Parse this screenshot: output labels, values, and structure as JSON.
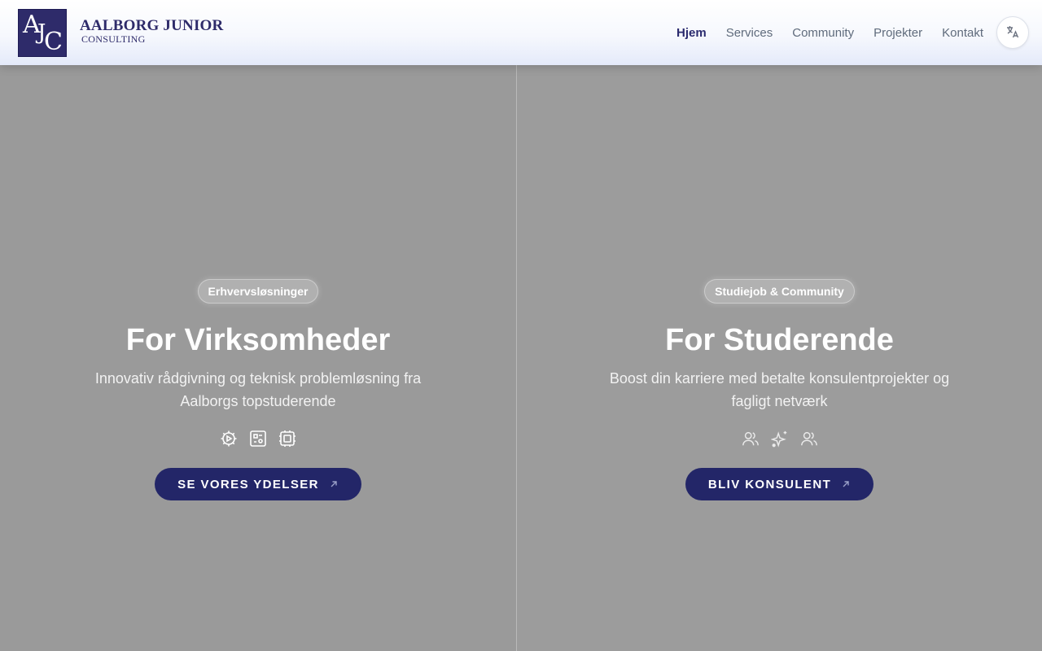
{
  "header": {
    "logo": {
      "mark": {
        "a": "A",
        "j": "J",
        "c": "C"
      },
      "line1": "AALBORG JUNIOR",
      "line2": "CONSULTING"
    },
    "nav": [
      {
        "label": "Hjem",
        "active": true
      },
      {
        "label": "Services",
        "active": false
      },
      {
        "label": "Community",
        "active": false
      },
      {
        "label": "Projekter",
        "active": false
      },
      {
        "label": "Kontakt",
        "active": false
      }
    ],
    "language_icon": "translate-icon"
  },
  "panels": {
    "business": {
      "badge": "Erhvervsløsninger",
      "title": "For Virksomheder",
      "subtitle": "Innovativ rådgivning og teknisk problemløsning fra Aalborgs topstuderende",
      "icons": [
        "play-target-icon",
        "diagram-box-icon",
        "chip-icon"
      ],
      "cta": "SE VORES YDELSER"
    },
    "students": {
      "badge": "Studiejob & Community",
      "title": "For Studerende",
      "subtitle": "Boost din karriere med betalte konsulentprojekter og fagligt netværk",
      "icons": [
        "users-icon",
        "sparkles-icon",
        "users-icon"
      ],
      "cta": "BLIV KONSULENT"
    }
  },
  "colors": {
    "brand": "#2e2b6a",
    "cta": "#232668",
    "nav_active": "#2a2a6e",
    "nav": "#5f6b7c"
  }
}
